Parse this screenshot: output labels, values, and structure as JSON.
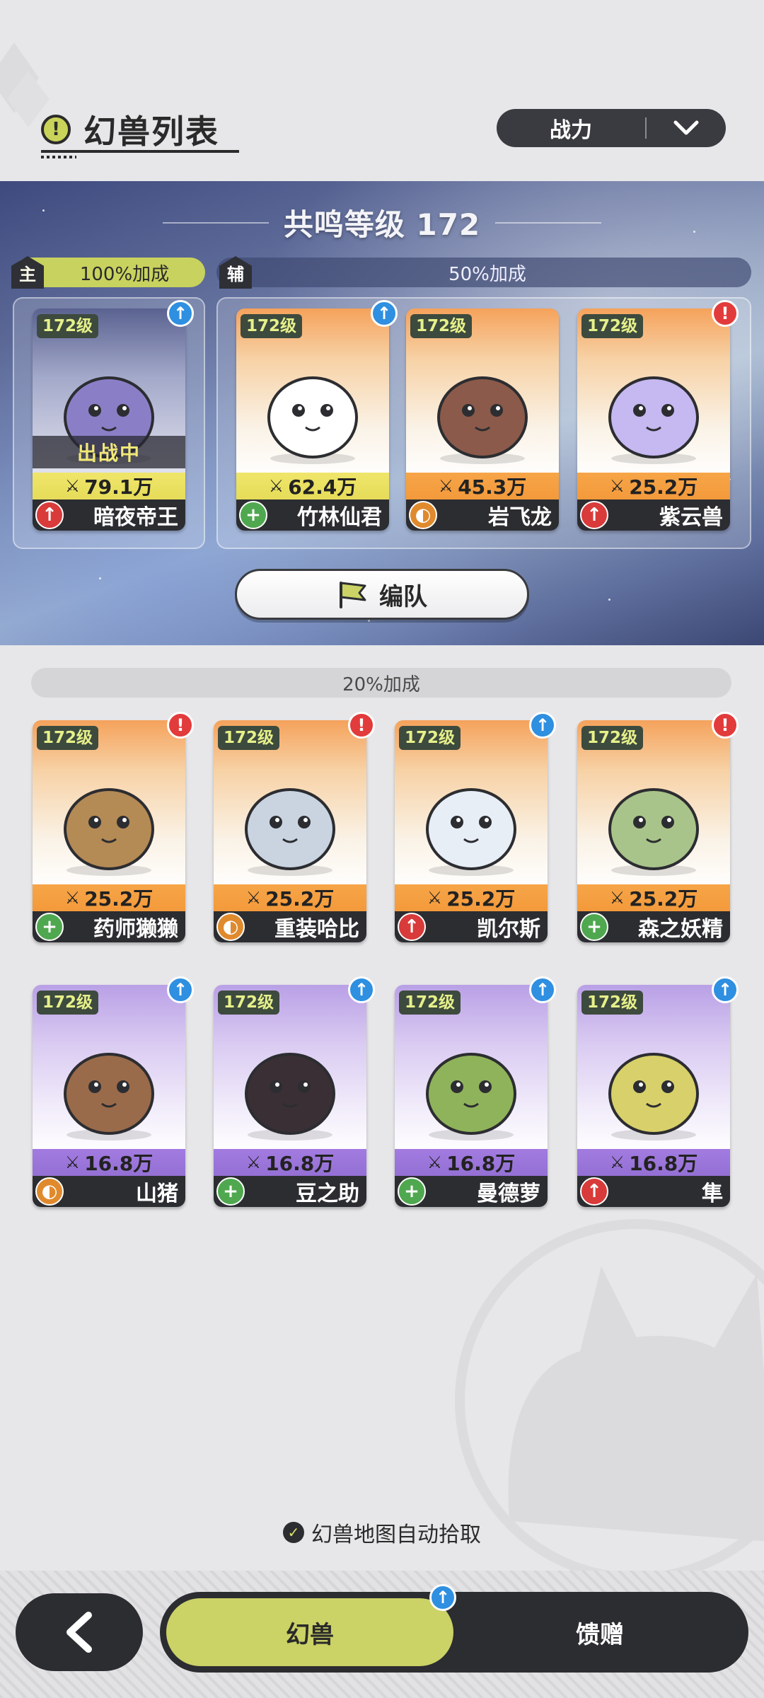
{
  "header": {
    "title": "幻兽列表",
    "title_icon": "!",
    "sort": {
      "selected": "战力"
    }
  },
  "team": {
    "resonance_label": "共鸣等级 172",
    "main_tag": "主",
    "main_bonus": "100%加成",
    "sub_tag": "辅",
    "sub_bonus": "50%加成",
    "in_battle_label": "出战中",
    "formation_label": "编队",
    "cards": [
      {
        "level": "172级",
        "power": "79.1万",
        "name": "暗夜帝王",
        "role": "attack",
        "badge": "up",
        "theme": "dark"
      },
      {
        "level": "172级",
        "power": "62.4万",
        "name": "竹林仙君",
        "role": "heal",
        "badge": "up",
        "theme": "yellow"
      },
      {
        "level": "172级",
        "power": "45.3万",
        "name": "岩飞龙",
        "role": "defense",
        "badge": "",
        "theme": "orange"
      },
      {
        "level": "172级",
        "power": "25.2万",
        "name": "紫云兽",
        "role": "attack",
        "badge": "alert",
        "theme": "orange"
      }
    ]
  },
  "bench": {
    "bonus": "20%加成",
    "cards": [
      {
        "level": "172级",
        "power": "25.2万",
        "name": "药师獭獭",
        "role": "heal",
        "badge": "alert",
        "theme": "orange"
      },
      {
        "level": "172级",
        "power": "25.2万",
        "name": "重装哈比",
        "role": "defense",
        "badge": "alert",
        "theme": "orange"
      },
      {
        "level": "172级",
        "power": "25.2万",
        "name": "凯尔斯",
        "role": "attack",
        "badge": "up",
        "theme": "orange"
      },
      {
        "level": "172级",
        "power": "25.2万",
        "name": "森之妖精",
        "role": "heal",
        "badge": "alert",
        "theme": "orange"
      },
      {
        "level": "172级",
        "power": "16.8万",
        "name": "山猪",
        "role": "defense",
        "badge": "up",
        "theme": "purple"
      },
      {
        "level": "172级",
        "power": "16.8万",
        "name": "豆之助",
        "role": "heal",
        "badge": "up",
        "theme": "purple"
      },
      {
        "level": "172级",
        "power": "16.8万",
        "name": "曼德萝",
        "role": "heal",
        "badge": "up",
        "theme": "purple"
      },
      {
        "level": "172级",
        "power": "16.8万",
        "name": "隼",
        "role": "attack",
        "badge": "up",
        "theme": "purple"
      }
    ]
  },
  "footer": {
    "auto_pickup_label": "幻兽地图自动拾取",
    "tabs": [
      {
        "label": "幻兽",
        "active": true
      },
      {
        "label": "馈赠",
        "active": false
      }
    ]
  },
  "colors": {
    "accent": "#cbd266",
    "dark": "#2c2d31",
    "attack": "#d93a3a",
    "heal": "#4fa84f",
    "defense": "#e08a2e",
    "upgrade": "#2f8fe0"
  }
}
